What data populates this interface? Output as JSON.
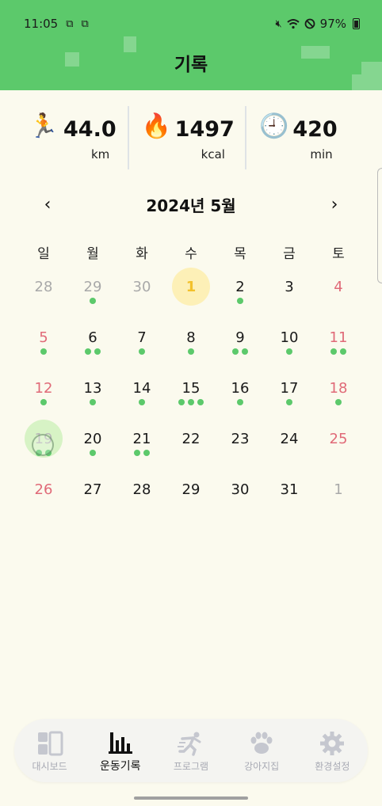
{
  "status_bar": {
    "time": "11:05",
    "left_icons": [
      "screenshot-icon",
      "screenshot-icon"
    ],
    "battery": "97%",
    "right_icons": [
      "mute-icon",
      "wifi-icon",
      "dnd-icon",
      "battery-icon"
    ]
  },
  "header": {
    "title": "기록",
    "color": "#5cc96b"
  },
  "stats": [
    {
      "icon": "🏃",
      "icon_name": "runner-icon",
      "value": "44.0",
      "unit": "km"
    },
    {
      "icon": "🔥",
      "icon_name": "fire-icon",
      "value": "1497",
      "unit": "kcal"
    },
    {
      "icon": "🕘",
      "icon_name": "clock-icon",
      "value": "420",
      "unit": "min"
    }
  ],
  "calendar": {
    "month_title": "2024년 5월",
    "prev_label": "‹",
    "next_label": "›",
    "weekdays": [
      "일",
      "월",
      "화",
      "수",
      "목",
      "금",
      "토"
    ],
    "days": [
      {
        "n": "28",
        "other": true,
        "dots": 0
      },
      {
        "n": "29",
        "other": true,
        "dots": 1
      },
      {
        "n": "30",
        "other": true,
        "dots": 0
      },
      {
        "n": "1",
        "selected": true,
        "dots": 0
      },
      {
        "n": "2",
        "dots": 1
      },
      {
        "n": "3",
        "dots": 0
      },
      {
        "n": "4",
        "red": true,
        "dots": 0
      },
      {
        "n": "5",
        "red": true,
        "dots": 1
      },
      {
        "n": "6",
        "dots": 2
      },
      {
        "n": "7",
        "dots": 1
      },
      {
        "n": "8",
        "dots": 1
      },
      {
        "n": "9",
        "dots": 2
      },
      {
        "n": "10",
        "dots": 1
      },
      {
        "n": "11",
        "red": true,
        "dots": 2
      },
      {
        "n": "12",
        "red": true,
        "dots": 1
      },
      {
        "n": "13",
        "dots": 1
      },
      {
        "n": "14",
        "dots": 1
      },
      {
        "n": "15",
        "dots": 3
      },
      {
        "n": "16",
        "dots": 1
      },
      {
        "n": "17",
        "dots": 1
      },
      {
        "n": "18",
        "red": true,
        "dots": 1
      },
      {
        "n": "19",
        "today": true,
        "dots": 2
      },
      {
        "n": "20",
        "dots": 1
      },
      {
        "n": "21",
        "dots": 2
      },
      {
        "n": "22",
        "dots": 0
      },
      {
        "n": "23",
        "dots": 0
      },
      {
        "n": "24",
        "dots": 0
      },
      {
        "n": "25",
        "red": true,
        "dots": 0
      },
      {
        "n": "26",
        "red": true,
        "dots": 0
      },
      {
        "n": "27",
        "dots": 0
      },
      {
        "n": "28",
        "dots": 0
      },
      {
        "n": "29",
        "dots": 0
      },
      {
        "n": "30",
        "dots": 0
      },
      {
        "n": "31",
        "dots": 0
      },
      {
        "n": "1",
        "other": true,
        "dots": 0
      }
    ]
  },
  "bottom_nav": [
    {
      "label": "대시보드",
      "icon": "dashboard-icon",
      "active": false
    },
    {
      "label": "운동기록",
      "icon": "bar-chart-icon",
      "active": true
    },
    {
      "label": "프로그램",
      "icon": "runner-icon",
      "active": false
    },
    {
      "label": "강아지집",
      "icon": "paw-icon",
      "active": false
    },
    {
      "label": "환경설정",
      "icon": "gear-icon",
      "active": false
    }
  ],
  "colors": {
    "accent": "#5cc96b",
    "weekend": "#e06a78",
    "selected_bg": "#fdf0b7",
    "selected_text": "#f3c12b",
    "inactive_nav": "#a8aab4"
  }
}
